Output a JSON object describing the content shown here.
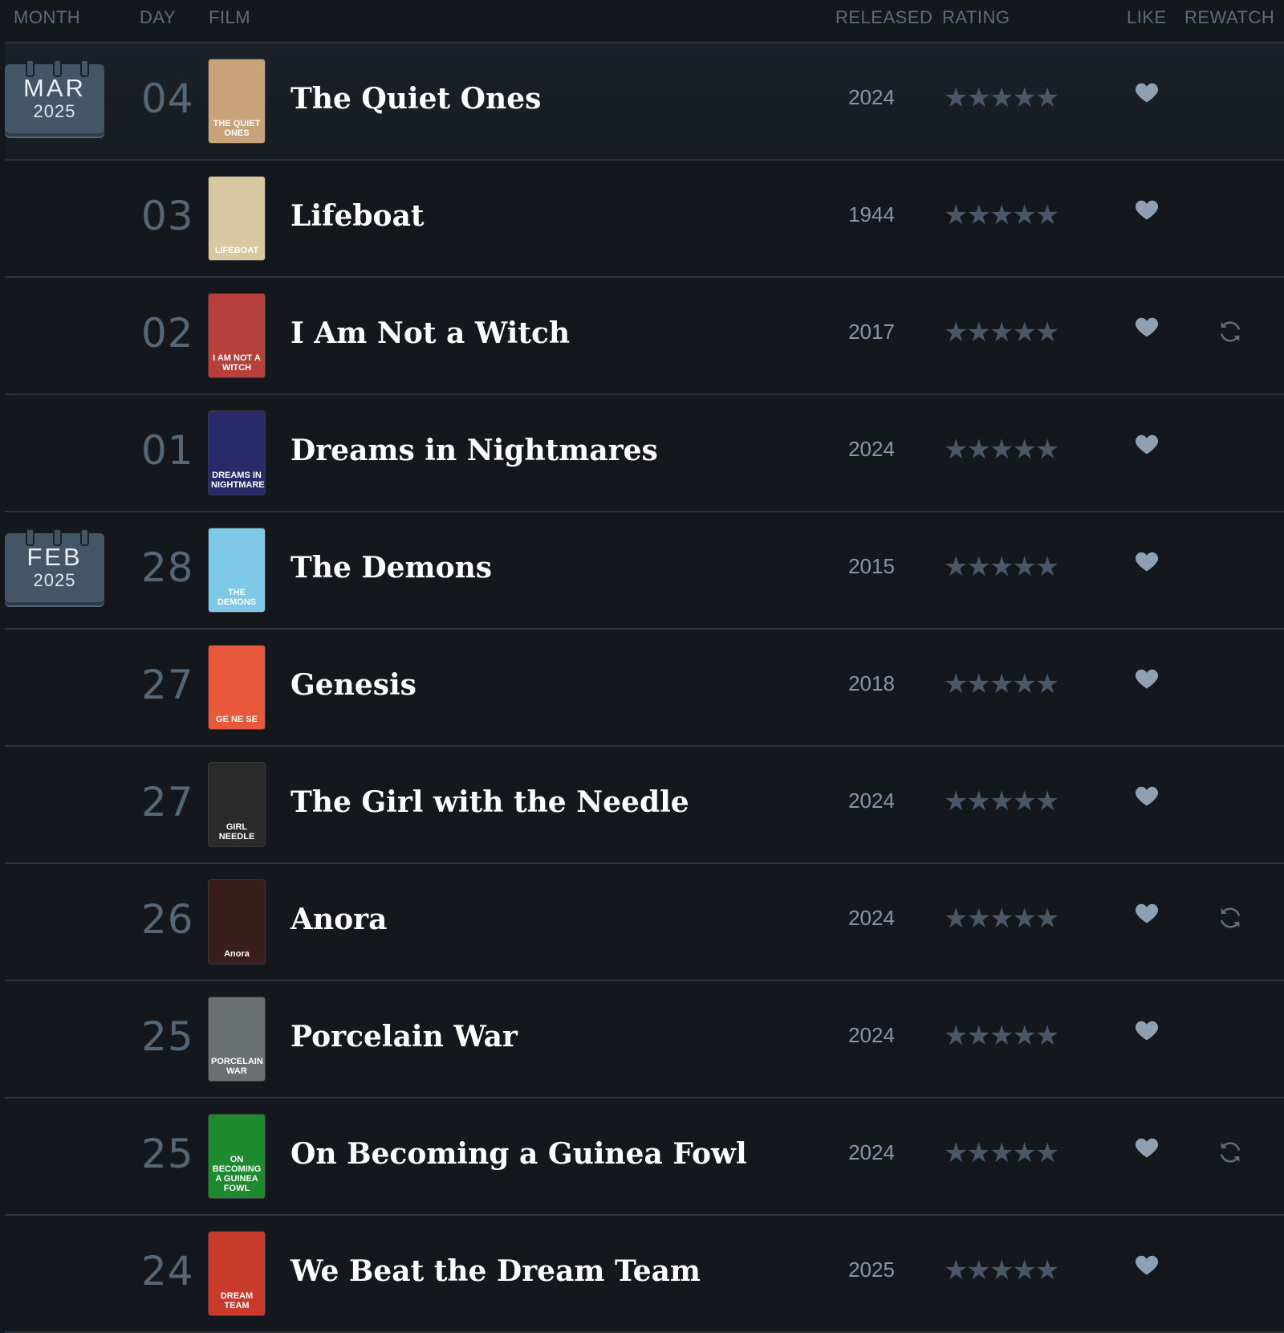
{
  "columns": {
    "month": "MONTH",
    "day": "DAY",
    "film": "FILM",
    "released": "RELEASED",
    "rating": "RATING",
    "like": "LIKE",
    "rewatch": "REWATCH"
  },
  "colors": {
    "background": "#14181c",
    "calendar": "#445566",
    "star": "#4a5766",
    "heart": "#8ea0b2"
  },
  "icons": [
    "star-icon",
    "heart-icon",
    "rewatch-icon"
  ],
  "entries": [
    {
      "month": "MAR",
      "year": "2025",
      "day": "04",
      "title": "The Quiet Ones",
      "released": "2024",
      "rating_stars": 5,
      "liked": true,
      "rewatch": false,
      "poster_text": "THE QUIET ONES",
      "poster_color": "#c8a37a"
    },
    {
      "month": "",
      "year": "",
      "day": "03",
      "title": "Lifeboat",
      "released": "1944",
      "rating_stars": 5,
      "liked": true,
      "rewatch": false,
      "poster_text": "LIFEBOAT",
      "poster_color": "#d8c8a0"
    },
    {
      "month": "",
      "year": "",
      "day": "02",
      "title": "I Am Not a Witch",
      "released": "2017",
      "rating_stars": 5,
      "liked": true,
      "rewatch": true,
      "poster_text": "I AM NOT A WITCH",
      "poster_color": "#b8403a"
    },
    {
      "month": "",
      "year": "",
      "day": "01",
      "title": "Dreams in Nightmares",
      "released": "2024",
      "rating_stars": 5,
      "liked": true,
      "rewatch": false,
      "poster_text": "DREAMS IN NIGHTMARES",
      "poster_color": "#2a2a6a"
    },
    {
      "month": "FEB",
      "year": "2025",
      "day": "28",
      "title": "The Demons",
      "released": "2015",
      "rating_stars": 5,
      "liked": true,
      "rewatch": false,
      "poster_text": "THE DEMONS",
      "poster_color": "#7ec8e8"
    },
    {
      "month": "",
      "year": "",
      "day": "27",
      "title": "Genesis",
      "released": "2018",
      "rating_stars": 5,
      "liked": true,
      "rewatch": false,
      "poster_text": "GE NE SE",
      "poster_color": "#e8583a"
    },
    {
      "month": "",
      "year": "",
      "day": "27",
      "title": "The Girl with the Needle",
      "released": "2024",
      "rating_stars": 5,
      "liked": true,
      "rewatch": false,
      "poster_text": "GIRL NEEDLE",
      "poster_color": "#2a2a2a"
    },
    {
      "month": "",
      "year": "",
      "day": "26",
      "title": "Anora",
      "released": "2024",
      "rating_stars": 5,
      "liked": true,
      "rewatch": true,
      "poster_text": "Anora",
      "poster_color": "#3a1e1e"
    },
    {
      "month": "",
      "year": "",
      "day": "25",
      "title": "Porcelain War",
      "released": "2024",
      "rating_stars": 5,
      "liked": true,
      "rewatch": false,
      "poster_text": "PORCELAIN WAR",
      "poster_color": "#6a7070"
    },
    {
      "month": "",
      "year": "",
      "day": "25",
      "title": "On Becoming a Guinea Fowl",
      "released": "2024",
      "rating_stars": 5,
      "liked": true,
      "rewatch": true,
      "poster_text": "ON BECOMING A GUINEA FOWL",
      "poster_color": "#1e8a2e"
    },
    {
      "month": "",
      "year": "",
      "day": "24",
      "title": "We Beat the Dream Team",
      "released": "2025",
      "rating_stars": 5,
      "liked": true,
      "rewatch": false,
      "poster_text": "DREAM TEAM",
      "poster_color": "#c83a2a"
    }
  ]
}
